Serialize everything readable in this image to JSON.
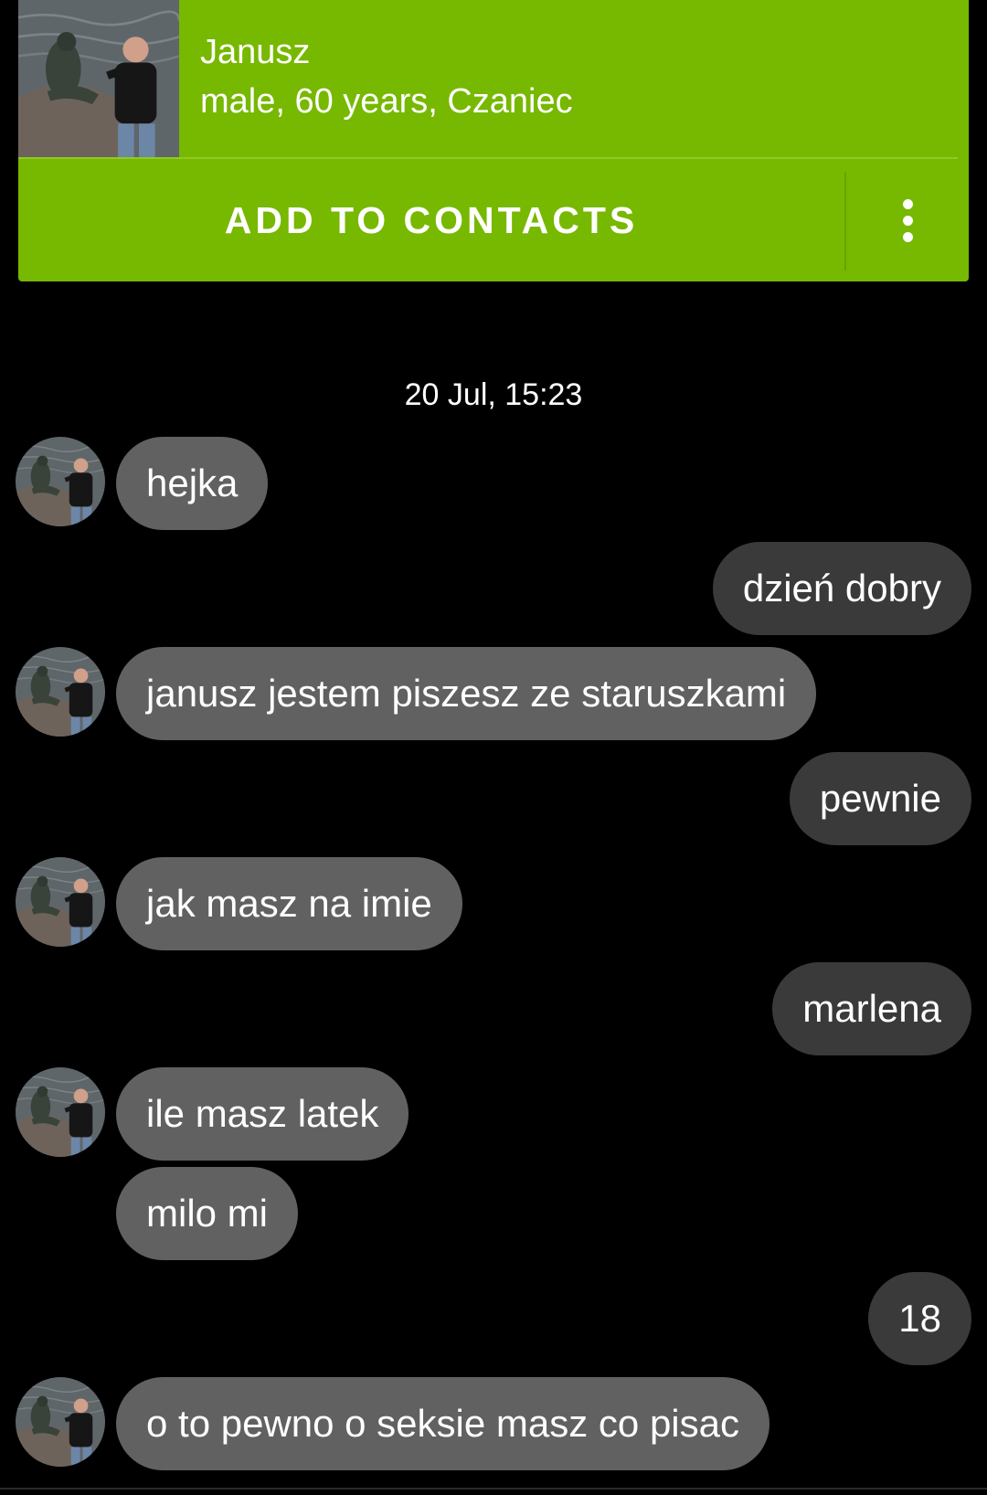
{
  "profile": {
    "name": "Janusz",
    "details": "male, 60 years, Czaniec",
    "add_button_label": "ADD TO CONTACTS",
    "more_icon": "more-vert-icon"
  },
  "colors": {
    "header_green": "#77b800",
    "incoming_bubble": "#616161",
    "outgoing_bubble": "#3a3a3a",
    "background": "#000000"
  },
  "chat": {
    "date_separator": "20 Jul, 15:23",
    "messages": [
      {
        "direction": "in",
        "text": "hejka",
        "avatar": true
      },
      {
        "direction": "out",
        "text": "dzień dobry"
      },
      {
        "direction": "in",
        "text": "janusz jestem piszesz ze staruszkami",
        "avatar": true
      },
      {
        "direction": "out",
        "text": "pewnie"
      },
      {
        "direction": "in",
        "text": "jak masz na imie",
        "avatar": true
      },
      {
        "direction": "out",
        "text": "marlena"
      },
      {
        "direction": "in",
        "text": "ile masz latek",
        "avatar": true
      },
      {
        "direction": "in",
        "text": "milo mi",
        "avatar": false
      },
      {
        "direction": "out",
        "text": "18"
      },
      {
        "direction": "in",
        "text": "o to pewno o seksie masz co pisac",
        "avatar": true
      }
    ]
  }
}
